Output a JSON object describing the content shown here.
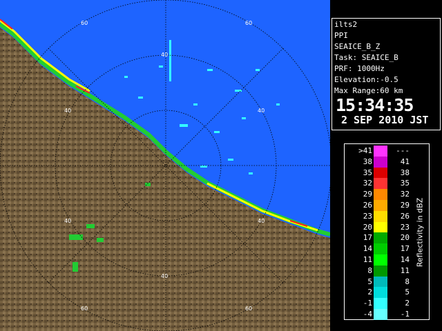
{
  "radar": {
    "range_label": "40",
    "range_labels": [
      "60",
      "60",
      "40",
      "40",
      "40",
      "40",
      "40",
      "60",
      "60"
    ]
  },
  "info": {
    "lines": [
      "ilts2",
      "PPI",
      "SEAICE_B_Z",
      "Task: SEAICE_B",
      "PRF: 1000Hz",
      "Elevation:-0.5",
      "Max Range:60 km"
    ],
    "time": "15:34:35",
    "date": "2 SEP 2010 JST"
  },
  "legend": {
    "title": "Reflectivity in dBZ",
    "rows": [
      {
        "low": ">41",
        "high": "---",
        "color": "#ff33ff"
      },
      {
        "low": "38",
        "high": "41",
        "color": "#cc00cc"
      },
      {
        "low": "35",
        "high": "38",
        "color": "#dd0000"
      },
      {
        "low": "32",
        "high": "35",
        "color": "#ff3333"
      },
      {
        "low": "29",
        "high": "32",
        "color": "#ff8800"
      },
      {
        "low": "26",
        "high": "29",
        "color": "#ffaa00"
      },
      {
        "low": "23",
        "high": "26",
        "color": "#ffdd00"
      },
      {
        "low": "20",
        "high": "23",
        "color": "#ffff00"
      },
      {
        "low": "17",
        "high": "20",
        "color": "#00aa00"
      },
      {
        "low": "14",
        "high": "17",
        "color": "#00cc00"
      },
      {
        "low": "11",
        "high": "14",
        "color": "#00ff00"
      },
      {
        "low": "8",
        "high": "11",
        "color": "#009900"
      },
      {
        "low": "5",
        "high": "8",
        "color": "#00bbbb"
      },
      {
        "low": "2",
        "high": "5",
        "color": "#00dddd"
      },
      {
        "low": "-1",
        "high": "2",
        "color": "#33ffff"
      },
      {
        "low": "-4",
        "high": "-1",
        "color": "#66ffff"
      }
    ]
  },
  "colors": {
    "sea": "#1e64ff",
    "land": "#6e5a3e",
    "land_dark": "#4e3e28",
    "coast_echo_green": "#22cc33",
    "coast_echo_yellow": "#ffff00",
    "coast_echo_red": "#ff2222"
  }
}
